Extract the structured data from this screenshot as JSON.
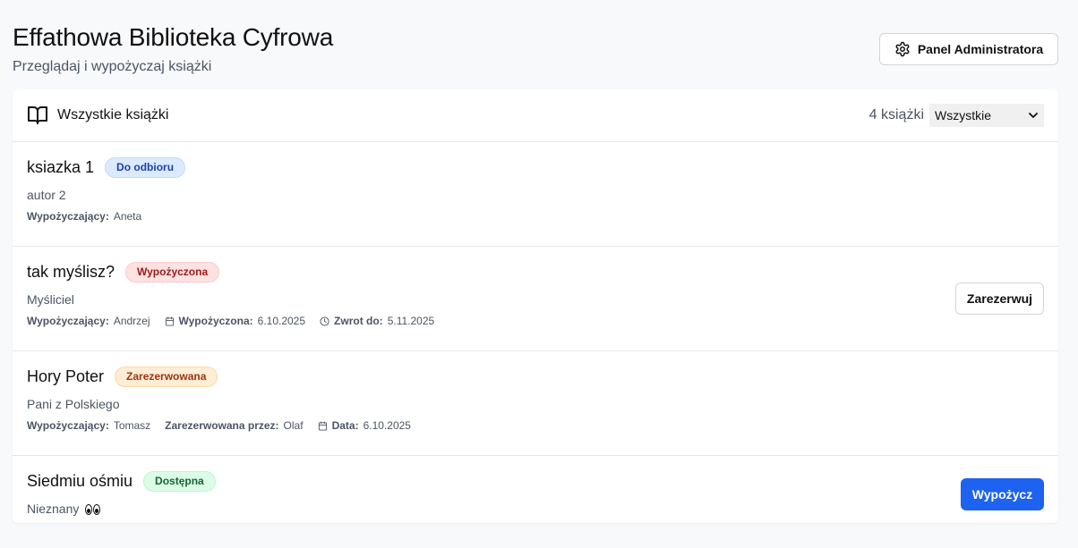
{
  "header": {
    "title": "Effathowa Biblioteka Cyfrowa",
    "subtitle": "Przeglądaj i wypożyczaj książki",
    "admin_button": "Panel Administratora"
  },
  "list": {
    "title": "Wszystkie książki",
    "count": "4 książki",
    "filter": {
      "selected": "Wszystkie"
    }
  },
  "books": [
    {
      "title": "ksiazka 1",
      "status": "Do odbioru",
      "author": "autor 2",
      "borrower_label": "Wypożyczający:",
      "borrower": "Aneta"
    },
    {
      "title": "tak myślisz?",
      "status": "Wypożyczona",
      "author": "Myśliciel",
      "borrower_label": "Wypożyczający:",
      "borrower": "Andrzej",
      "borrowed_label": "Wypożyczona:",
      "borrowed_date": "6.10.2025",
      "due_label": "Zwrot do:",
      "due_date": "5.11.2025",
      "action": "Zarezerwuj"
    },
    {
      "title": "Hory Poter",
      "status": "Zarezerwowana",
      "author": "Pani z Polskiego",
      "borrower_label": "Wypożyczający:",
      "borrower": "Tomasz",
      "reserved_by_label": "Zarezerwowana przez:",
      "reserved_by": "Olaf",
      "date_label": "Data:",
      "date": "6.10.2025"
    },
    {
      "title": "Siedmiu ośmiu",
      "status": "Dostępna",
      "author": "Nieznany",
      "author_icon": "eyes-icon",
      "action": "Wypożycz"
    }
  ],
  "colors": {
    "primary": "#1d62f0",
    "status_pickup": "#1e40af",
    "status_borrowed": "#991b1b",
    "status_reserved": "#9a3412",
    "status_available": "#166534"
  }
}
